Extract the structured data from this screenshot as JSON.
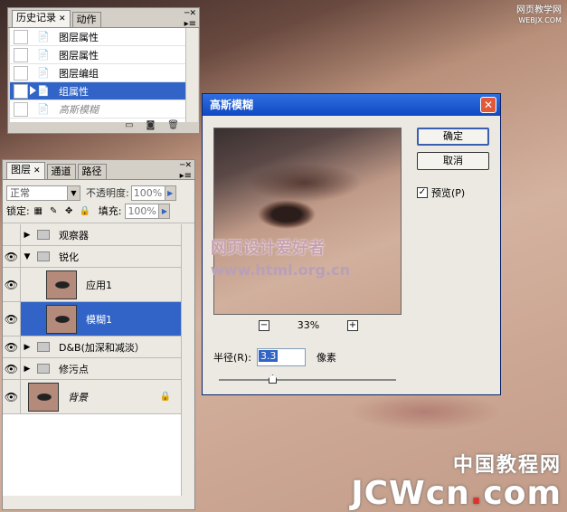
{
  "watermark_top": {
    "line1": "网页教学网",
    "line2": "WEBJX.COM"
  },
  "watermark_bottom": {
    "cn": "中国教程网",
    "en_main": "JCWcn",
    "en_dot": ".",
    "en_tail": "com"
  },
  "history": {
    "tabs": [
      "历史记录",
      "动作"
    ],
    "rows": [
      {
        "label": "图层属性",
        "state": "normal"
      },
      {
        "label": "图层属性",
        "state": "normal"
      },
      {
        "label": "图层编组",
        "state": "normal"
      },
      {
        "label": "组属性",
        "state": "selected"
      },
      {
        "label": "高斯模糊",
        "state": "dimmed"
      }
    ]
  },
  "layers": {
    "tabs": [
      "图层",
      "通道",
      "路径"
    ],
    "blend_mode": "正常",
    "opacity_label": "不透明度:",
    "opacity": "100%",
    "lock_label": "锁定:",
    "fill_label": "填充:",
    "fill": "100%",
    "rows": [
      {
        "name": "观察器",
        "type": "group",
        "visible": false,
        "expanded": false
      },
      {
        "name": "锐化",
        "type": "group",
        "visible": true,
        "expanded": true
      },
      {
        "name": "应用1",
        "type": "layer",
        "visible": true
      },
      {
        "name": "模糊1",
        "type": "layer",
        "visible": true,
        "selected": true
      },
      {
        "name": "D&B(加深和减淡）",
        "type": "group",
        "visible": true,
        "expanded": false
      },
      {
        "name": "修污点",
        "type": "group",
        "visible": true,
        "expanded": false
      },
      {
        "name": "背景",
        "type": "background",
        "visible": true,
        "locked": true
      }
    ]
  },
  "dialog": {
    "title": "高斯模糊",
    "ok": "确定",
    "cancel": "取消",
    "preview_label": "预览(P)",
    "preview_checked": true,
    "zoom": "33%",
    "radius_label": "半径(R):",
    "radius_value": "3.3",
    "radius_unit": "像素",
    "preview_watermark_cn": "网页设计爱好者",
    "preview_watermark_url": "www.html.org.cn"
  }
}
